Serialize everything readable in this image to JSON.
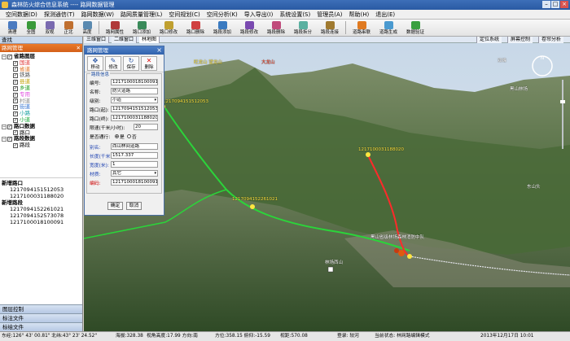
{
  "window": {
    "title": "森林防火综合信息系统 ---- 路网数据管理"
  },
  "menu": [
    "空间数据(D)",
    "探测通信(T)",
    "路网数据(W)",
    "路网质量管理(L)",
    "空间规划(C)",
    "空间分析(K)",
    "导入导出(I)",
    "系统设置(S)",
    "管理员(A)",
    "帮助(H)",
    "退出(E)"
  ],
  "toolbar": [
    "清理",
    "全图",
    "双视",
    "正北",
    "高度",
    "路网属性",
    "路口添加",
    "路口修改",
    "路口删除",
    "路段添加",
    "路段修改",
    "路段删除",
    "路段拆分",
    "路段连接",
    "道路串联",
    "道路生成",
    "数据验证"
  ],
  "left": {
    "search_label": "查找",
    "panel_title": "路网管理",
    "tree": {
      "root": "省路图层",
      "items": [
        {
          "label": "国道",
          "color": "#e03c3c"
        },
        {
          "label": "省道",
          "color": "#e07020"
        },
        {
          "label": "铁路",
          "color": "#555555"
        },
        {
          "label": "县道",
          "color": "#c0a000"
        },
        {
          "label": "乡道",
          "color": "#1a9a1a"
        },
        {
          "label": "专用",
          "color": "#e050e0"
        },
        {
          "label": "村道",
          "color": "#888888"
        },
        {
          "label": "街道",
          "color": "#3070d0"
        },
        {
          "label": "小路",
          "color": "#19a0a0"
        },
        {
          "label": "小道",
          "color": "#1aaa3a"
        }
      ],
      "group2": "路口数据",
      "group2_items": [
        "路口"
      ],
      "group3": "路段数据",
      "group3_items": [
        "路段"
      ]
    },
    "new_junction_title": "新增路口",
    "new_junctions": [
      "1217094151512053",
      "1217100031188020"
    ],
    "new_road_title": "新增路段",
    "new_roads": [
      "1217094152261021",
      "1217094152573078",
      "1217100018100091"
    ],
    "bottom_tabs": [
      "图层控制",
      "标注文件",
      "标绘文件"
    ]
  },
  "map_tabs": {
    "left": [
      "三维窗口",
      "二维窗口",
      "林地图"
    ],
    "right": [
      "定位系统",
      "屏幕控制",
      "卷帘分析"
    ]
  },
  "dialog": {
    "title": "路网管理",
    "tools": [
      "移动",
      "修改",
      "保存",
      "删除"
    ],
    "legend": "路段信息",
    "fields": {
      "id_label": "编号:",
      "id_value": "1217100018100091",
      "name_label": "名称:",
      "name_value": "防火道路",
      "level_label": "级别:",
      "level_value": "小道",
      "j1_label": "路口(起):",
      "j1_value": "1217094151512053",
      "j2_label": "路口(终):",
      "j2_value": "1217100031188020",
      "speed_label": "限速(千米/小时):",
      "speed_value": "20",
      "pass_label": "是否通行:",
      "pass_yes": "是",
      "pass_no": "否",
      "alias_label": "别名:",
      "alias_value": "西山林间道路",
      "length_label": "长度(千米):",
      "length_value": "1517.337",
      "width_label": "宽度(米):",
      "width_value": "1",
      "material_label": "材质:",
      "material_value": "其它",
      "num_label": "编码:",
      "num_value": "1217100018100091"
    },
    "ok": "确定",
    "cancel": "取消"
  },
  "map_labels": {
    "l1": "旺龙山 望龙山",
    "l2": "大龙山",
    "l3": "双峰",
    "l4": "1217094151512053",
    "l5": "1217100031188020",
    "l6": "1217094152261021",
    "l7": "黑山省级林场森林消防中队",
    "l8": "林场西山",
    "l9": "黑山林场",
    "l10": "东山头"
  },
  "status": {
    "coords": "东经:126° 43' 00.81\" 北纬:43° 23' 24.52\"",
    "elev": "海拔:328.38",
    "view": "视角高度:17.99 方向:南",
    "pos": "方位:358.15 俯仰:-15.59",
    "dist": "视距:570.08",
    "login": "登录: 较河",
    "state": "当前状态: 林网路编辑模式",
    "date": "2013年12月17日 10:01"
  }
}
